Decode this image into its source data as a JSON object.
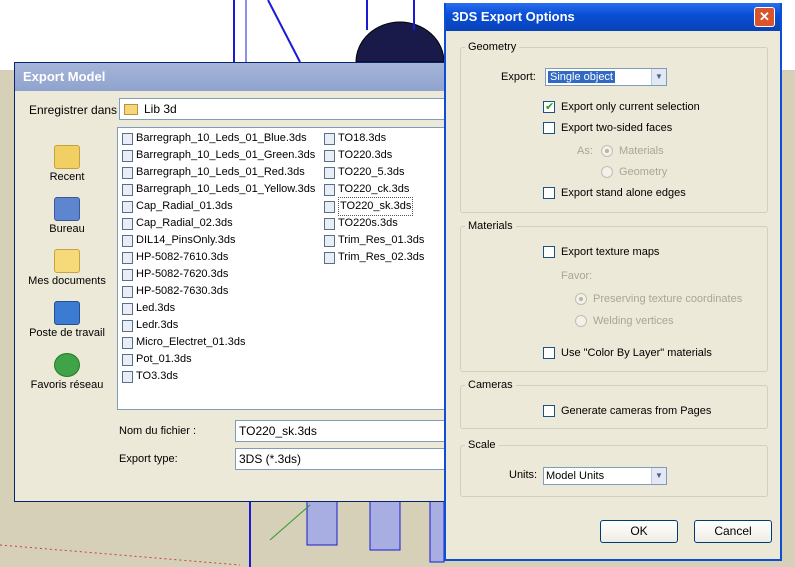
{
  "export_model": {
    "title": "Export Model",
    "save_in_label": "Enregistrer dans :",
    "folder": "Lib 3d",
    "places": [
      {
        "label": "Recent",
        "icon": "recent-folder-icon"
      },
      {
        "label": "Bureau",
        "icon": "desktop-icon"
      },
      {
        "label": "Mes documents",
        "icon": "my-documents-icon"
      },
      {
        "label": "Poste de travail",
        "icon": "my-computer-icon"
      },
      {
        "label": "Favoris réseau",
        "icon": "network-places-icon"
      }
    ],
    "files_col1": [
      "Barregraph_10_Leds_01_Blue.3ds",
      "Barregraph_10_Leds_01_Green.3ds",
      "Barregraph_10_Leds_01_Red.3ds",
      "Barregraph_10_Leds_01_Yellow.3ds",
      "Cap_Radial_01.3ds",
      "Cap_Radial_02.3ds",
      "DIL14_PinsOnly.3ds",
      "HP-5082-7610.3ds",
      "HP-5082-7620.3ds",
      "HP-5082-7630.3ds",
      "Led.3ds",
      "Ledr.3ds",
      "Micro_Electret_01.3ds",
      "Pot_01.3ds",
      "TO3.3ds"
    ],
    "files_col2": [
      "TO18.3ds",
      "TO220.3ds",
      "TO220_5.3ds",
      "TO220_ck.3ds",
      "TO220_sk.3ds",
      "TO220s.3ds",
      "Trim_Res_01.3ds",
      "Trim_Res_02.3ds"
    ],
    "selected_file": "TO220_sk.3ds",
    "filename_label": "Nom du fichier :",
    "filename_value": "TO220_sk.3ds",
    "type_label": "Export type:",
    "type_value": "3DS (*.3ds)"
  },
  "options": {
    "title": "3DS Export Options",
    "close_glyph": "✕",
    "geometry": {
      "legend": "Geometry",
      "export_label": "Export:",
      "export_value": "Single object",
      "only_selection": {
        "label": "Export only current selection",
        "checked": true
      },
      "two_sided": {
        "label": "Export two-sided faces",
        "checked": false
      },
      "as_label": "As:",
      "as_materials": {
        "label": "Materials",
        "selected": true
      },
      "as_geometry": {
        "label": "Geometry",
        "selected": false
      },
      "standalone_edges": {
        "label": "Export stand alone edges",
        "checked": false
      }
    },
    "materials": {
      "legend": "Materials",
      "texture_maps": {
        "label": "Export texture maps",
        "checked": false
      },
      "favor_label": "Favor:",
      "preserve_coords": {
        "label": "Preserving texture coordinates",
        "selected": true
      },
      "welding": {
        "label": "Welding vertices",
        "selected": false
      },
      "color_by_layer": {
        "label": "Use \"Color By Layer\" materials",
        "checked": false
      }
    },
    "cameras": {
      "legend": "Cameras",
      "generate": {
        "label": "Generate cameras from Pages",
        "checked": false
      }
    },
    "scale": {
      "legend": "Scale",
      "units_label": "Units:",
      "units_value": "Model Units"
    },
    "ok_label": "OK",
    "cancel_label": "Cancel"
  }
}
